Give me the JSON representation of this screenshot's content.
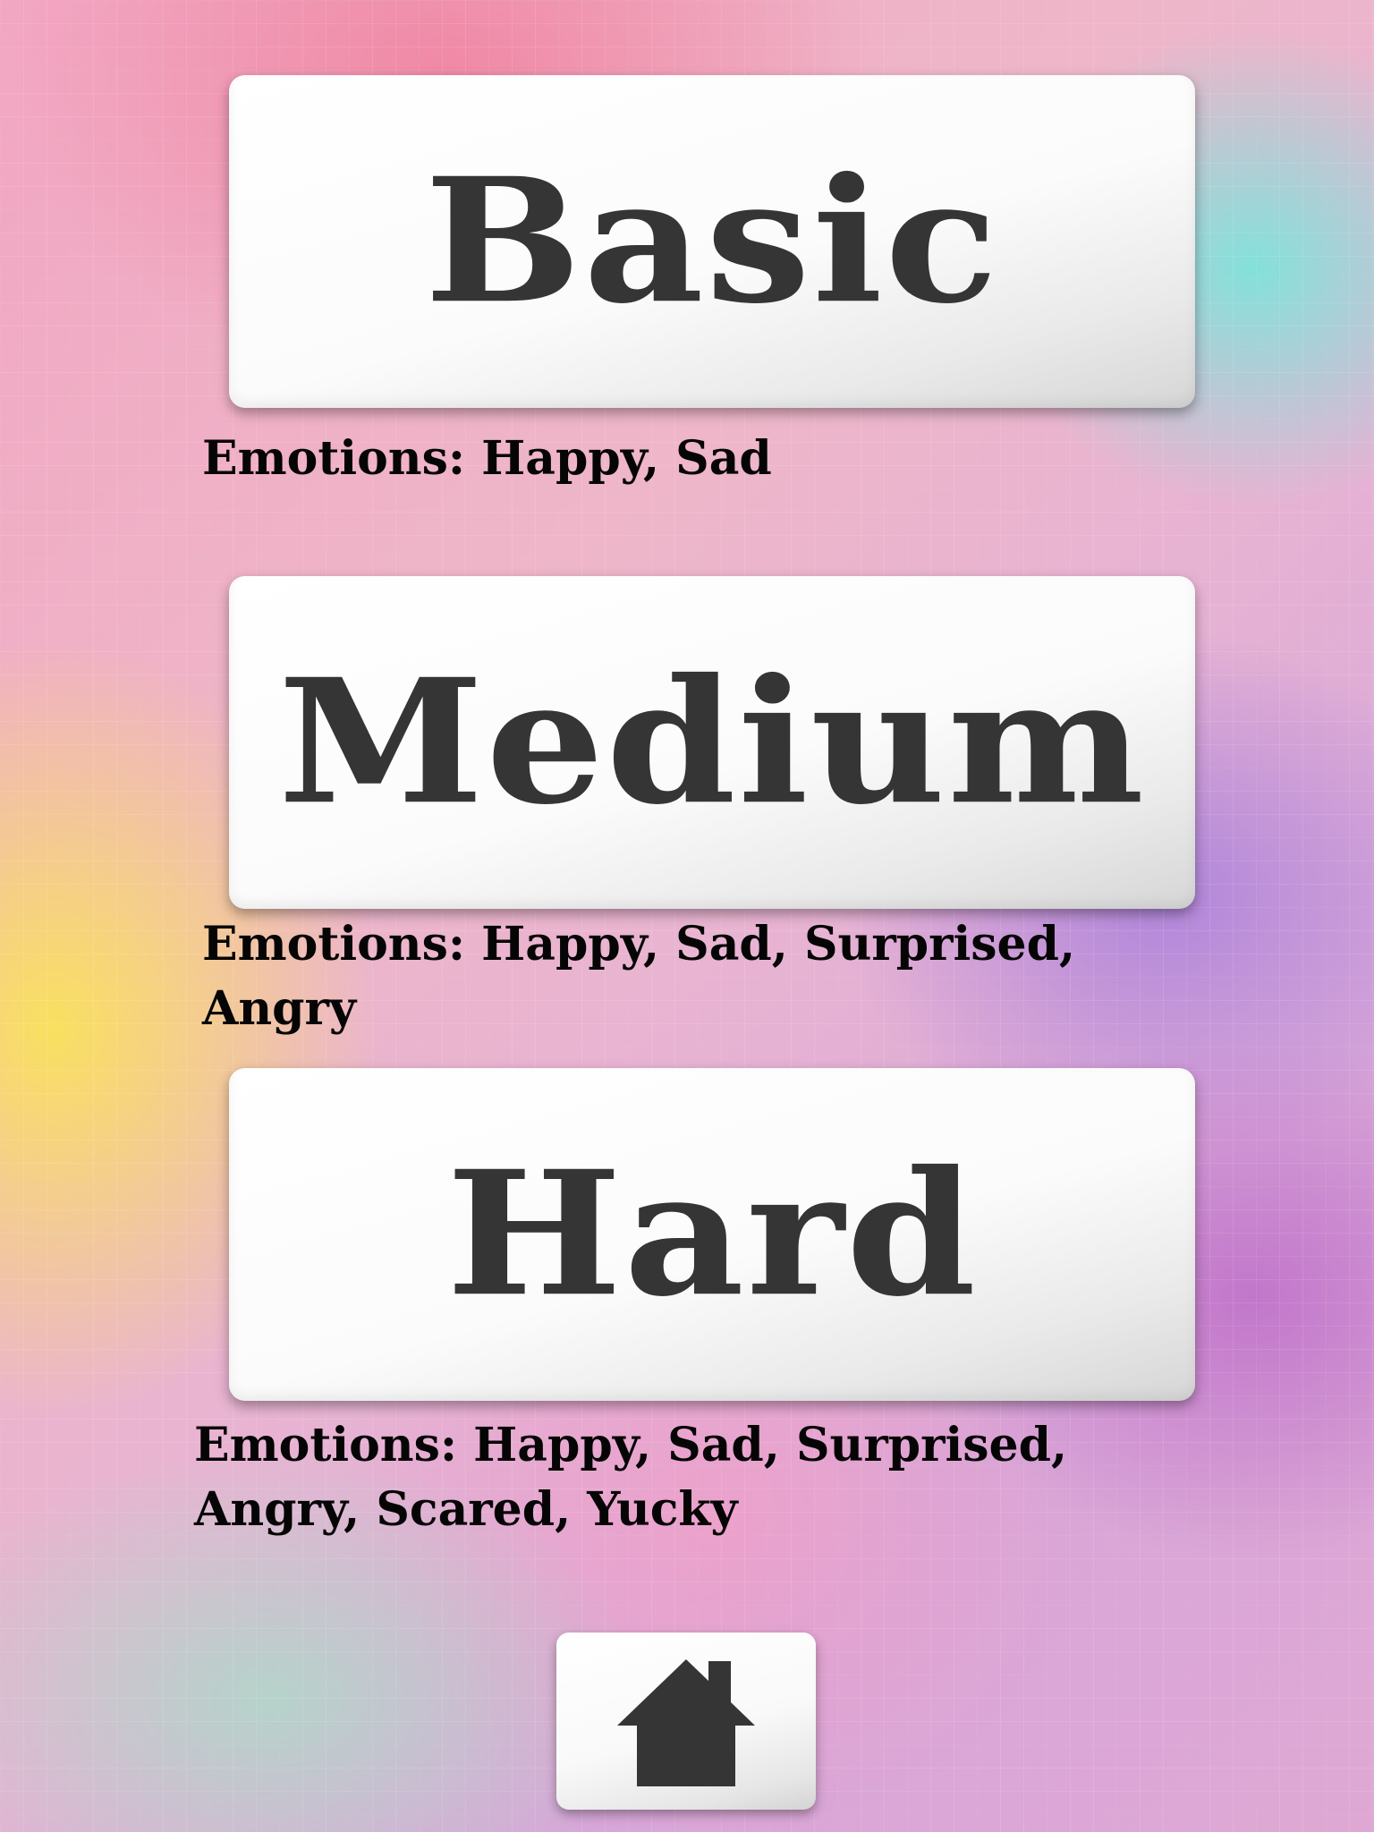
{
  "levels": [
    {
      "label": "Basic",
      "description_lines": [
        "Emotions: Happy, Sad"
      ]
    },
    {
      "label": "Medium",
      "description_lines": [
        "Emotions: Happy, Sad, Surprised,",
        "Angry"
      ]
    },
    {
      "label": "Hard",
      "description_lines": [
        "Emotions: Happy, Sad, Surprised,",
        "Angry, Scared, Yucky"
      ]
    }
  ],
  "home_button": {
    "icon": "home-icon"
  },
  "colors": {
    "button_text": "#353535",
    "description_text": "#050505",
    "button_face": "#ffffff"
  }
}
